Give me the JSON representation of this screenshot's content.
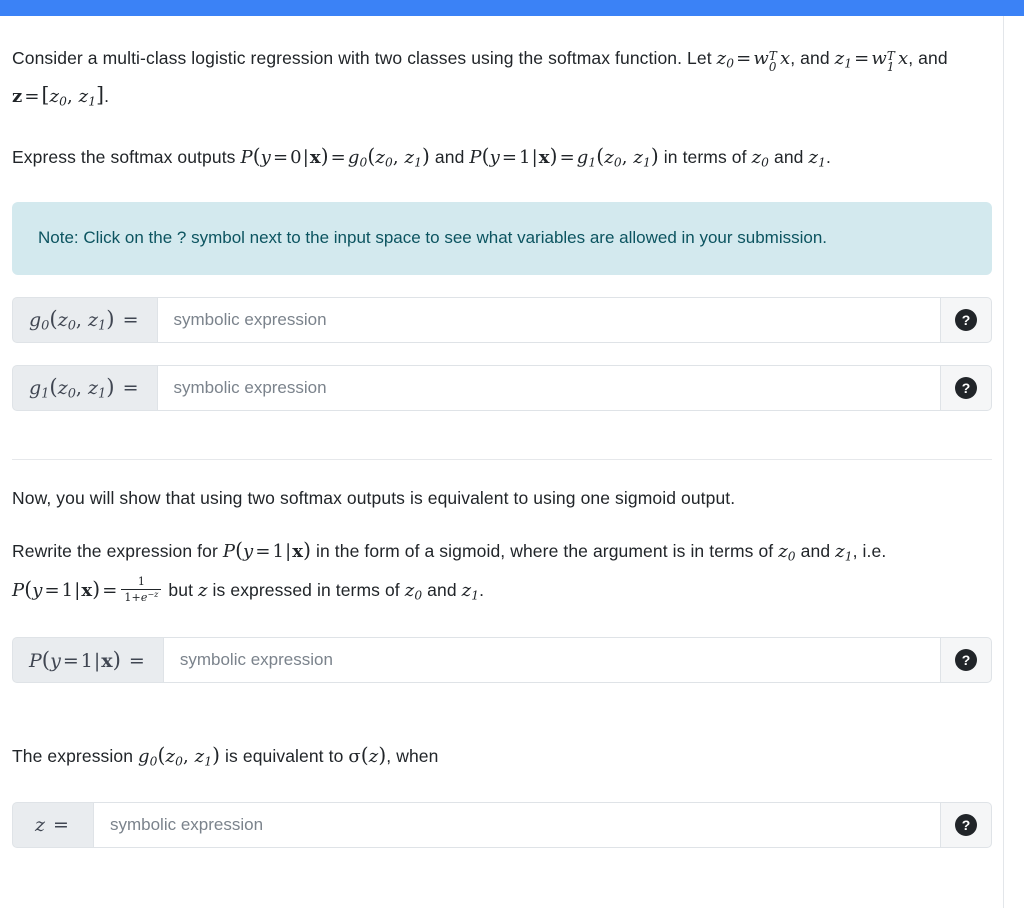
{
  "topbar": {
    "color": "#3b82f6"
  },
  "intro": {
    "line1_a": "Consider a multi-class logistic regression with two classes using the softmax function. Let ",
    "line1_b": ", and ",
    "line1_c": ", and ",
    "line1_d": "."
  },
  "express": {
    "a": "Express the softmax outputs ",
    "b": " and ",
    "c": " in terms of ",
    "d": " and ",
    "e": "."
  },
  "note": {
    "text": "Note: Click on the ? symbol next to the input space to see what variables are allowed in your submission."
  },
  "inputs": [
    {
      "label_tex": "g_0(z_0, z_1) =",
      "value": "",
      "placeholder": "symbolic expression",
      "help_glyph": "?"
    },
    {
      "label_tex": "g_1(z_0, z_1) =",
      "value": "",
      "placeholder": "symbolic expression",
      "help_glyph": "?"
    },
    {
      "label_tex": "P(y = 1|x) =",
      "value": "",
      "placeholder": "symbolic expression",
      "help_glyph": "?"
    },
    {
      "label_tex": "z =",
      "value": "",
      "placeholder": "symbolic expression",
      "help_glyph": "?"
    }
  ],
  "section2": {
    "intro": "Now, you will show that using two softmax outputs is equivalent to using one sigmoid output.",
    "rewrite_a": "Rewrite the expression for ",
    "rewrite_b": " in the form of a sigmoid, where the argument is in terms of ",
    "rewrite_c": " and ",
    "rewrite_d": ", i.e. ",
    "rewrite_e": " but ",
    "rewrite_f": " is expressed in terms of ",
    "rewrite_g": " and ",
    "rewrite_h": "."
  },
  "section3": {
    "a": "The expression ",
    "b": " is equivalent to ",
    "c": ", when"
  },
  "math_symbols": {
    "z0": "z₀",
    "z1": "z₁",
    "w0T_x": "w₀ᵀx",
    "w1T_x": "w₁ᵀx",
    "z_vector": "z = [z₀, z₁]",
    "P_y0_x": "P(y = 0|x)",
    "P_y1_x": "P(y = 1|x)",
    "g0": "g₀(z₀, z₁)",
    "g1": "g₁(z₀, z₁)",
    "sigmoid_frac_num": "1",
    "sigmoid_frac_den": "1+e⁻ᶻ",
    "sigma_z": "σ(z)",
    "z": "z"
  }
}
